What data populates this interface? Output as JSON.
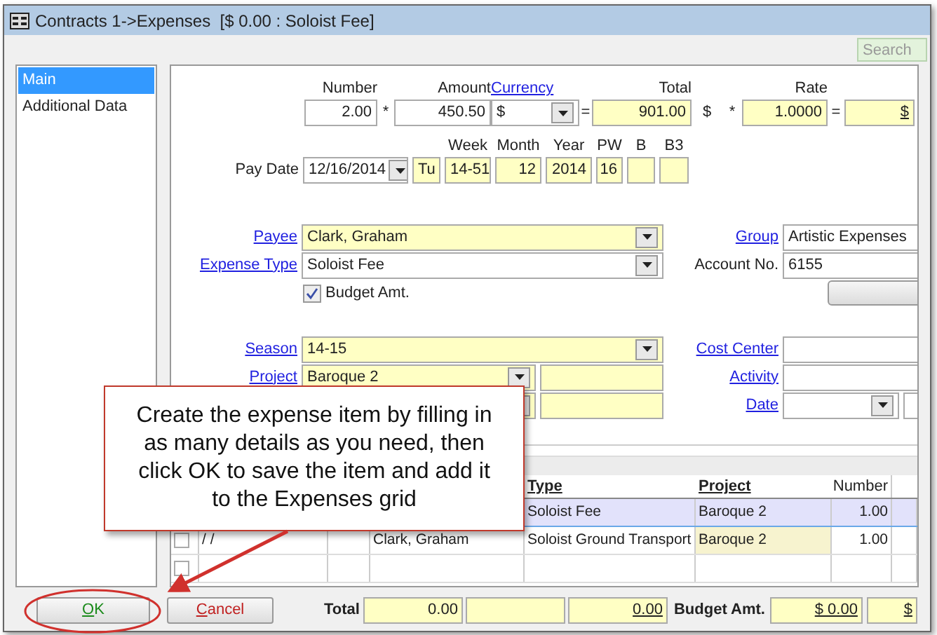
{
  "window": {
    "title": "Contracts 1->Expenses  [$ 0.00 : Soloist Fee]"
  },
  "search": {
    "placeholder": "Search"
  },
  "nav": [
    {
      "label": "Main",
      "selected": true
    },
    {
      "label": "Additional Data",
      "selected": false
    }
  ],
  "calculation": [
    {
      "kind": "field",
      "label": "Number",
      "link": false,
      "value": "2.00",
      "required": false,
      "underlined": false
    },
    {
      "kind": "operator",
      "value": "*"
    },
    {
      "kind": "field",
      "label": "Amount",
      "link": false,
      "value": "450.50",
      "required": false,
      "underlined": false
    },
    {
      "kind": "dropdown",
      "label": "Currency",
      "link": true,
      "value": "$",
      "required": false,
      "underlined": false
    },
    {
      "kind": "operator",
      "value": "="
    },
    {
      "kind": "field",
      "label": "Total",
      "link": false,
      "value": "901.00",
      "required": true,
      "underlined": false
    },
    {
      "kind": "operator",
      "value": "$"
    },
    {
      "kind": "operator",
      "value": "*"
    },
    {
      "kind": "field",
      "label": "Rate",
      "link": false,
      "value": "1.0000",
      "required": true,
      "underlined": false
    },
    {
      "kind": "operator",
      "value": "="
    },
    {
      "kind": "field",
      "value": "$",
      "required": true,
      "underlined": true
    }
  ],
  "pay_date": {
    "label": "Pay Date",
    "value": "12/16/2014"
  },
  "weekday": {
    "value": "Tu"
  },
  "periods": [
    {
      "label": "Week",
      "value": "14-51"
    },
    {
      "label": "Month",
      "value": "12"
    },
    {
      "label": "Year",
      "value": "2014"
    },
    {
      "label": "PW",
      "value": "16"
    },
    {
      "label": "B"
    },
    {
      "label": "B3"
    }
  ],
  "details_left": [
    {
      "kind": "dropdown",
      "label": "Payee",
      "link": true,
      "value": "Clark, Graham",
      "required": true
    },
    {
      "kind": "dropdown",
      "label": "Expense Type",
      "link": true,
      "value": "Soloist Fee",
      "required": false
    },
    {
      "kind": "checkbox",
      "label": "Budget Amt.",
      "checked": true
    },
    {
      "kind": "blank"
    },
    {
      "kind": "dropdown",
      "label": "Season",
      "link": true,
      "value": "14-15",
      "required": true
    },
    {
      "kind": "split",
      "label": "Project",
      "link": true,
      "value": "Baroque 2",
      "required": true
    },
    {
      "kind": "split",
      "required": true
    }
  ],
  "details_right": [
    {
      "kind": "text",
      "label": "Group",
      "link": true,
      "value": "Artistic Expenses"
    },
    {
      "kind": "text",
      "label": "Account No.",
      "link": false,
      "value": "6155"
    },
    {
      "kind": "button"
    },
    {
      "kind": "blank"
    },
    {
      "kind": "text",
      "label": "Cost Center",
      "link": true
    },
    {
      "kind": "text",
      "label": "Activity",
      "link": true
    },
    {
      "kind": "date",
      "label": "Date",
      "link": true
    }
  ],
  "grid": {
    "columns": [
      {
        "label": "Type",
        "kind": "type"
      },
      {
        "label": "Project",
        "kind": "project"
      },
      {
        "label": "Number",
        "kind": "number"
      }
    ],
    "rows": [
      {
        "selected": true,
        "type": "Soloist Fee",
        "project": "Baroque 2",
        "number": "1.00"
      },
      {
        "selected": false,
        "checked": false,
        "date": "/ /",
        "payee": "Clark, Graham",
        "type": "Soloist Ground Transport",
        "project": "Baroque 2",
        "number": "1.00"
      },
      {
        "selected": false,
        "checked": false
      }
    ]
  },
  "footer": {
    "buttons": [
      {
        "label": "OK",
        "kind": "ok"
      },
      {
        "label": "Cancel",
        "kind": "cancel"
      }
    ],
    "total_label": "Total",
    "totals": [
      {
        "kind": "amount",
        "value": "0.00",
        "underlined": false
      },
      {
        "kind": "empty"
      },
      {
        "kind": "amount",
        "value": "0.00",
        "underlined": true
      }
    ],
    "budget_label": "Budget Amt.",
    "budget": [
      {
        "value": "$ 0.00",
        "underlined": true
      },
      {
        "value": "$",
        "underlined": true
      }
    ]
  },
  "callout": {
    "lines": [
      "Create the expense item by filling in",
      "as many details as you need, then",
      "click OK to save the item and add it",
      "to the Expenses grid"
    ]
  }
}
